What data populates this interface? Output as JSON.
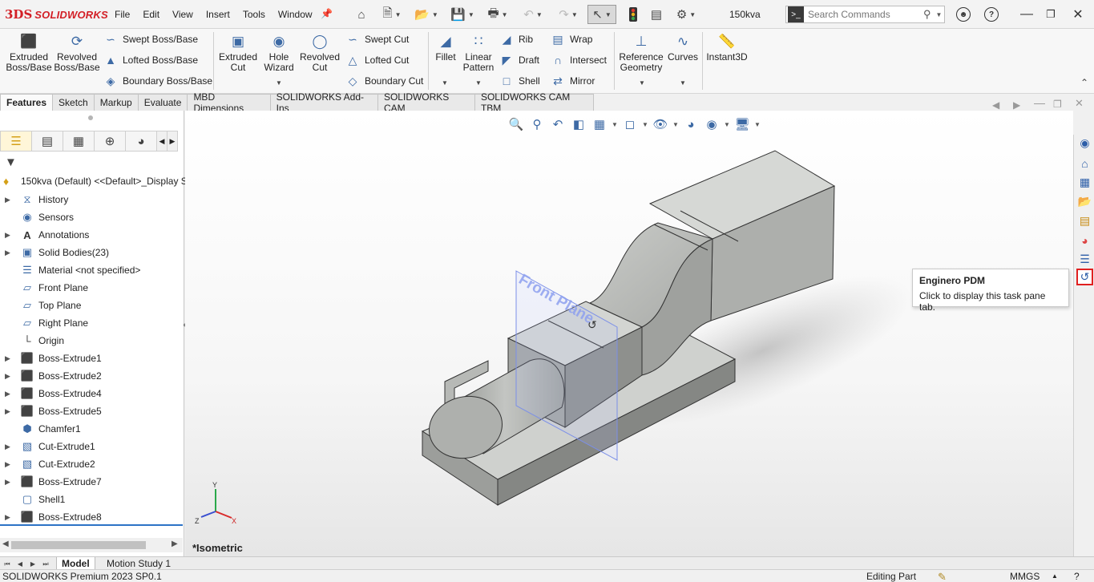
{
  "app": {
    "logo_ds": "3DS",
    "logo_text": "SOLIDWORKS",
    "menu": [
      "File",
      "Edit",
      "View",
      "Insert",
      "Tools",
      "Window"
    ],
    "document_name": "150kva",
    "search_placeholder": "Search Commands"
  },
  "ribbon": {
    "extruded_boss": "Extruded Boss/Base",
    "revolved_boss": "Revolved Boss/Base",
    "swept_boss": "Swept Boss/Base",
    "lofted_boss": "Lofted Boss/Base",
    "boundary_boss": "Boundary Boss/Base",
    "extruded_cut": "Extruded Cut",
    "hole_wizard": "Hole Wizard",
    "revolved_cut": "Revolved Cut",
    "swept_cut": "Swept Cut",
    "lofted_cut": "Lofted Cut",
    "boundary_cut": "Boundary Cut",
    "fillet": "Fillet",
    "linear_pattern": "Linear Pattern",
    "rib": "Rib",
    "draft": "Draft",
    "shell": "Shell",
    "wrap": "Wrap",
    "intersect": "Intersect",
    "mirror": "Mirror",
    "reference_geometry": "Reference Geometry",
    "curves": "Curves",
    "instant3d": "Instant3D"
  },
  "tabs": [
    "Features",
    "Sketch",
    "Markup",
    "Evaluate",
    "MBD Dimensions",
    "SOLIDWORKS Add-Ins",
    "SOLIDWORKS CAM",
    "SOLIDWORKS CAM TBM"
  ],
  "feature_tree": {
    "root": "150kva (Default) <<Default>_Display S",
    "items": [
      {
        "label": "History",
        "icon": "history-icon",
        "expandable": true
      },
      {
        "label": "Sensors",
        "icon": "sensor-icon",
        "expandable": false
      },
      {
        "label": "Annotations",
        "icon": "annotation-icon",
        "expandable": true
      },
      {
        "label": "Solid Bodies(23)",
        "icon": "solid-bodies-icon",
        "expandable": true
      },
      {
        "label": "Material <not specified>",
        "icon": "material-icon",
        "expandable": false
      },
      {
        "label": "Front Plane",
        "icon": "plane-icon",
        "expandable": false
      },
      {
        "label": "Top Plane",
        "icon": "plane-icon",
        "expandable": false
      },
      {
        "label": "Right Plane",
        "icon": "plane-icon",
        "expandable": false
      },
      {
        "label": "Origin",
        "icon": "origin-icon",
        "expandable": false
      },
      {
        "label": "Boss-Extrude1",
        "icon": "extrude-icon",
        "expandable": true
      },
      {
        "label": "Boss-Extrude2",
        "icon": "extrude-icon",
        "expandable": true
      },
      {
        "label": "Boss-Extrude4",
        "icon": "extrude-icon",
        "expandable": true
      },
      {
        "label": "Boss-Extrude5",
        "icon": "extrude-icon",
        "expandable": true
      },
      {
        "label": "Chamfer1",
        "icon": "chamfer-icon",
        "expandable": false
      },
      {
        "label": "Cut-Extrude1",
        "icon": "cut-extrude-icon",
        "expandable": true
      },
      {
        "label": "Cut-Extrude2",
        "icon": "cut-extrude-icon",
        "expandable": true
      },
      {
        "label": "Boss-Extrude7",
        "icon": "extrude-icon",
        "expandable": true
      },
      {
        "label": "Shell1",
        "icon": "shell-icon",
        "expandable": false
      },
      {
        "label": "Boss-Extrude8",
        "icon": "extrude-icon",
        "expandable": true
      }
    ]
  },
  "viewport": {
    "plane_label": "Front Plane",
    "view_label": "*Isometric",
    "triad": {
      "x": "X",
      "y": "Y",
      "z": "Z"
    }
  },
  "tooltip": {
    "title": "Enginero PDM",
    "description": "Click to display this task pane tab."
  },
  "bottom_tabs": [
    "Model",
    "Motion Study 1"
  ],
  "status": {
    "product": "SOLIDWORKS Premium 2023 SP0.1",
    "mode": "Editing Part",
    "units": "MMGS"
  },
  "colors": {
    "brand": "#d31f26",
    "highlight_border": "#e02020",
    "plane": "#7b8fe8"
  }
}
